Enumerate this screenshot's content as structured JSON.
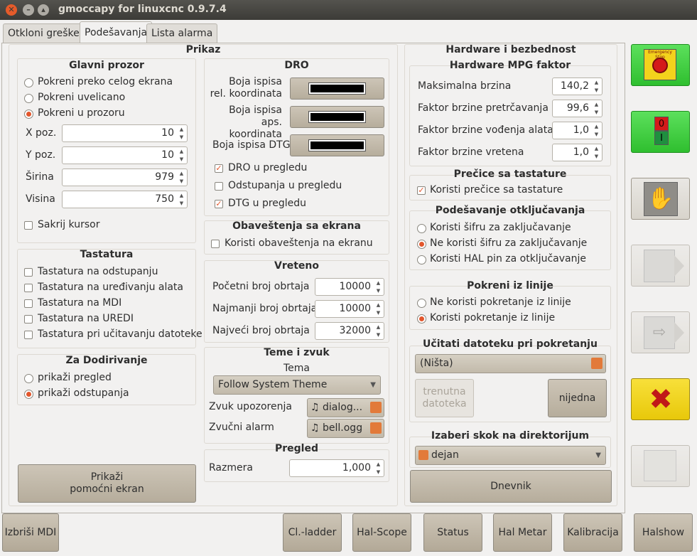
{
  "window": {
    "title": "gmoccapy for linuxcnc 0.9.7.4"
  },
  "tabs": [
    "Otkloni greške",
    "Podešavanja",
    "Lista alarma"
  ],
  "prikaz": {
    "title": "Prikaz",
    "glavni": {
      "title": "Glavni prozor",
      "r1": "Pokreni preko celog ekrana",
      "r2": "Pokreni uvelicano",
      "r3": "Pokreni u prozoru",
      "xpos_label": "X poz.",
      "xpos": "10",
      "ypos_label": "Y poz.",
      "ypos": "10",
      "width_label": "Širina",
      "width": "979",
      "height_label": "Visina",
      "height": "750",
      "hide_cursor": "Sakrij kursor"
    },
    "tastatura": {
      "title": "Tastatura",
      "c1": "Tastatura na odstupanju",
      "c2": "Tastatura na uređivanju alata",
      "c3": "Tastatura na MDI",
      "c4": "Tastatura na UREDI",
      "c5": "Tastatura pri učitavanju datoteke"
    },
    "dodir": {
      "title": "Za Dodirivanje",
      "r1": "prikaži pregled",
      "r2": "prikaži odstupanja"
    },
    "helper_btn": "Prikaži\npomoćni ekran",
    "dro": {
      "title": "DRO",
      "rel": "Boja ispisa\nrel. koordinata",
      "abs": "Boja ispisa\naps. koordinata",
      "dtg": "Boja ispisa DTG",
      "c1": "DRO u pregledu",
      "c2": "Odstupanja u pregledu",
      "c3": "DTG u pregledu"
    },
    "obav": {
      "title": "Obaveštenja sa ekrana",
      "c1": "Koristi obaveštenja na ekranu"
    },
    "vreteno": {
      "title": "Vreteno",
      "l1": "Početni broj obrtaja",
      "v1": "10000",
      "l2": "Najmanji broj obrtaja",
      "v2": "10000",
      "l3": "Najveći broj obrtaja",
      "v3": "32000"
    },
    "teme": {
      "title": "Teme i zvuk",
      "tema_label": "Tema",
      "tema": "Follow System Theme",
      "zvuk_label": "Zvuk upozorenja",
      "zvuk": "dialog...",
      "alarm_label": "Zvučni alarm",
      "alarm": "bell.ogg"
    },
    "pregled": {
      "title": "Pregled",
      "label": "Razmera",
      "value": "1,000"
    }
  },
  "hw": {
    "title": "Hardware i bezbednost",
    "mpg": {
      "title": "Hardware MPG faktor",
      "l1": "Maksimalna brzina",
      "v1": "140,2",
      "l2": "Faktor brzine pretrčavanja",
      "v2": "99,6",
      "l3": "Faktor brzine vođenja alata",
      "v3": "1,0",
      "l4": "Faktor brzine vretena",
      "v4": "1,0"
    },
    "precice": {
      "title": "Prečice sa tastature",
      "c1": "Koristi prečice sa tastature"
    },
    "otklj": {
      "title": "Podešavanje otključavanja",
      "r1": "Koristi šifru za zaključavanje",
      "r2": "Ne koristi šifru za zaključavanje",
      "r3": "Koristi HAL pin za otključavanje"
    },
    "linija": {
      "title": "Pokreni iz linije",
      "r1": "Ne koristi pokretanje iz linije",
      "r2": "Koristi pokretanje iz linije"
    },
    "ucitati": {
      "title": "Učitati datoteku pri pokretanju",
      "file": "(Ništa)",
      "btn1": "trenutna\ndatoteka",
      "btn2": "nijedna"
    },
    "skok": {
      "title": "Izaberi skok na direktorijum",
      "dir": "dejan"
    },
    "dnevnik": "Dnevnik"
  },
  "bottom": [
    "Izbriši MDI",
    "Cl.-ladder",
    "Hal-Scope",
    "Status",
    "Hal Metar",
    "Kalibracija",
    "Halshow"
  ],
  "side": {
    "estop_text": "Emergency Stop"
  }
}
